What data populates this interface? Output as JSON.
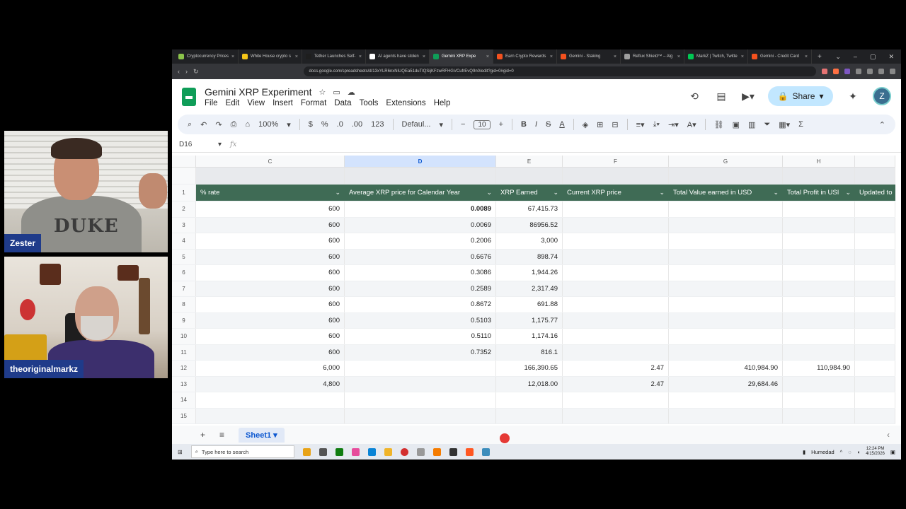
{
  "participants": [
    {
      "name": "Zester"
    },
    {
      "name": "theoriginalmarkz"
    }
  ],
  "cam1_shirt_text": "DUKE",
  "browser": {
    "tabs": [
      {
        "label": "Cryptocurrency Prices",
        "color": "#8bc34a"
      },
      {
        "label": "White House crypto s",
        "color": "#f5c518"
      },
      {
        "label": "Tether Launches Self-",
        "color": "#1e1e1e"
      },
      {
        "label": "AI agents have stolen",
        "color": "#ffffff"
      },
      {
        "label": "Gemini XRP Expe",
        "color": "#0f9d58",
        "active": true
      },
      {
        "label": "Earn Crypto Rewards",
        "color": "#f4511e"
      },
      {
        "label": "Gemini - Staking",
        "color": "#f4511e"
      },
      {
        "label": "Reflux Shield™ – Alg",
        "color": "#9e9e9e"
      },
      {
        "label": "MarkZ | Twitch, Twitte",
        "color": "#00c853"
      },
      {
        "label": "Gemini - Credit Card",
        "color": "#f4511e"
      }
    ],
    "url": "docs.google.com/spreadsheets/d/13xYLR6nxNiUQEa51duTlQSijKFzwRFHGVCufrEvQ9n0/edit?gid=0#gid=0"
  },
  "doc": {
    "title": "Gemini XRP Experiment",
    "menu": [
      "File",
      "Edit",
      "View",
      "Insert",
      "Format",
      "Data",
      "Tools",
      "Extensions",
      "Help"
    ],
    "share_label": "Share",
    "avatar_letter": "Z"
  },
  "toolbar": {
    "zoom": "100%",
    "currency": "$",
    "percent": "%",
    "dec_down": ".0",
    "dec_up": ".00",
    "number_format": "123",
    "font": "Defaul...",
    "font_size": "10"
  },
  "formula_bar": {
    "name_box": "D16",
    "fx": "fx"
  },
  "grid": {
    "columns": [
      "C",
      "D",
      "E",
      "F",
      "G",
      "H"
    ],
    "selected_column": "D",
    "header_row": {
      "num": "1",
      "cells": [
        "% rate",
        "Average XRP price for Calendar Year",
        "XRP Earned",
        "Current XRP price",
        "Total Value earned in USD",
        "Total Profit in USI",
        "Updated to"
      ]
    },
    "rows": [
      {
        "num": "2",
        "c": "600",
        "d": "0.0089",
        "e": "67,415.73",
        "f": "",
        "g": "",
        "h": ""
      },
      {
        "num": "3",
        "c": "600",
        "d": "0.0069",
        "e": "86956.52",
        "f": "",
        "g": "",
        "h": ""
      },
      {
        "num": "4",
        "c": "600",
        "d": "0.2006",
        "e": "3,000",
        "f": "",
        "g": "",
        "h": ""
      },
      {
        "num": "5",
        "c": "600",
        "d": "0.6676",
        "e": "898.74",
        "f": "",
        "g": "",
        "h": ""
      },
      {
        "num": "6",
        "c": "600",
        "d": "0.3086",
        "e": "1,944.26",
        "f": "",
        "g": "",
        "h": ""
      },
      {
        "num": "7",
        "c": "600",
        "d": "0.2589",
        "e": "2,317.49",
        "f": "",
        "g": "",
        "h": ""
      },
      {
        "num": "8",
        "c": "600",
        "d": "0.8672",
        "e": "691.88",
        "f": "",
        "g": "",
        "h": ""
      },
      {
        "num": "9",
        "c": "600",
        "d": "0.5103",
        "e": "1,175.77",
        "f": "",
        "g": "",
        "h": ""
      },
      {
        "num": "10",
        "c": "600",
        "d": "0.5110",
        "e": "1,174.16",
        "f": "",
        "g": "",
        "h": ""
      },
      {
        "num": "11",
        "c": "600",
        "d": "0.7352",
        "e": "816.1",
        "f": "",
        "g": "",
        "h": ""
      },
      {
        "num": "12",
        "c": "6,000",
        "d": "",
        "e": "166,390.65",
        "f": "2.47",
        "g": "410,984.90",
        "h": "110,984.90"
      },
      {
        "num": "13",
        "c": "4,800",
        "d": "",
        "e": "12,018.00",
        "f": "2.47",
        "g": "29,684.46",
        "h": ""
      },
      {
        "num": "14",
        "c": "",
        "d": "",
        "e": "",
        "f": "",
        "g": "",
        "h": ""
      },
      {
        "num": "15",
        "c": "",
        "d": "",
        "e": "",
        "f": "",
        "g": "",
        "h": ""
      }
    ]
  },
  "sheets": {
    "add": "+",
    "list": "≡",
    "active_tab": "Sheet1"
  },
  "taskbar": {
    "search_placeholder": "Type here to search",
    "weather": "Humedad",
    "time": "12:24 PM",
    "date": "4/15/2026"
  }
}
